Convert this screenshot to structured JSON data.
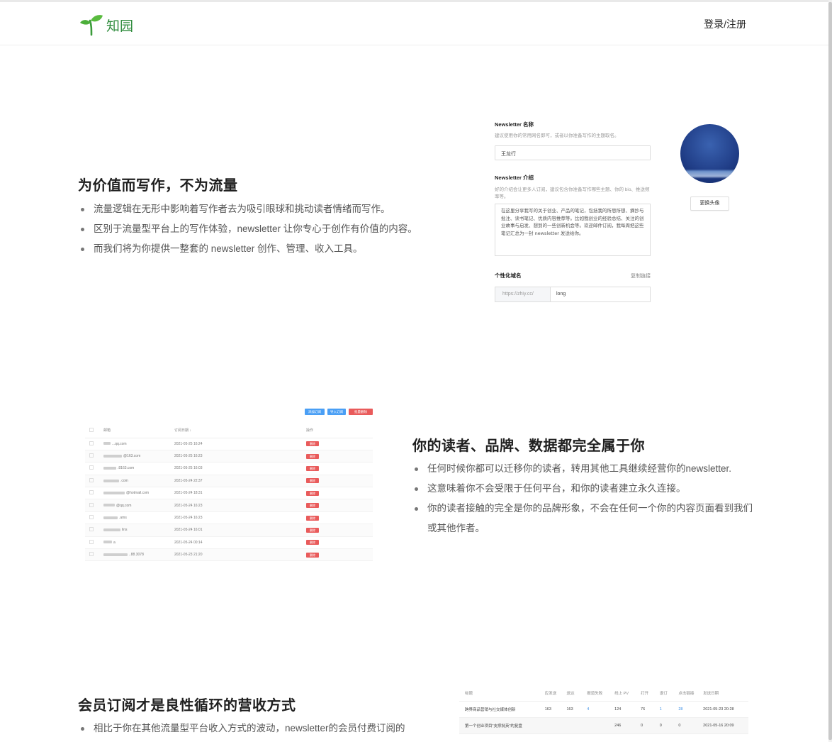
{
  "header": {
    "brand": "知园",
    "login_label": "登录/注册"
  },
  "section1": {
    "title": "为价值而写作，不为流量",
    "points": [
      "流量逻辑在无形中影响着写作者去为吸引眼球和挑动读者情绪而写作。",
      "区别于流量型平台上的写作体验，newsletter 让你专心于创作有价值的内容。",
      "而我们将为你提供一整套的 newsletter 创作、管理、收入工具。"
    ]
  },
  "form": {
    "name_label": "Newsletter 名称",
    "name_hint": "建议使用你的常用网名即可，或者以你准备写作的主题取名。",
    "name_value": "王龙行",
    "intro_label": "Newsletter 介绍",
    "intro_hint": "好的介绍会让更多人订阅，建议包含你准备写作哪些主题、你的 bio、推送频率等。",
    "intro_value": "在这里分享我写的关于创业、产品的笔记，包括我的所思所想、摘抄与批注、读书笔记、优质内容推荐等。比如我创业的经验总结、关注的创业故事与启发、想到的一些创新机会等。欢迎邮件订阅，我每周把这些笔记汇总为一封 newsletter 发送给你。",
    "domain_label": "个性化域名",
    "copy_link": "复制链接",
    "domain_prefix": "https://zhiy.cc/",
    "domain_value": "long",
    "change_avatar": "更换头像"
  },
  "section2": {
    "title": "你的读者、品牌、数据都完全属于你",
    "points": [
      "任何时候你都可以迁移你的读者，转用其他工具继续经营你的newsletter.",
      "这意味着你不会受限于任何平台，和你的读者建立永久连接。",
      "你的读者接触的完全是你的品牌形象，不会在任何一个你的内容页面看到我们或其他作者。"
    ]
  },
  "subs": {
    "buttons": [
      {
        "label": "添加订阅",
        "color": "#4a9ff5"
      },
      {
        "label": "导入订阅",
        "color": "#4a9ff5"
      },
      {
        "label": "批量删除",
        "color": "#e95b5b"
      }
    ],
    "columns": [
      "",
      "邮箱",
      "订阅日期 ↓",
      "操作"
    ],
    "delete_label": "删除",
    "rows": [
      {
        "email": "...qq.com",
        "date": "2021-05-25 16:24"
      },
      {
        "email": "@163.com",
        "date": "2021-05-25 16:23"
      },
      {
        "email": ".8163.com",
        "date": "2021-05-25 16:03"
      },
      {
        "email": ".com",
        "date": "2021-05-24 22:37"
      },
      {
        "email": "@hotmail.com",
        "date": "2021-05-24 18:31"
      },
      {
        "email": "@qq.com",
        "date": "2021-05-24 16:23"
      },
      {
        "email": ".ams",
        "date": "2021-05-24 16:23"
      },
      {
        "email": "lins",
        "date": "2021-05-24 16:01"
      },
      {
        "email": "a",
        "date": "2021-05-24 00:14"
      },
      {
        "email": "..88.3078",
        "date": "2021-05-23 21:20"
      }
    ]
  },
  "section3": {
    "title": "会员订阅才是良性循环的营收方式",
    "points": [
      "相比于你在其他流量型平台收入方式的波动，newsletter的会员付费订阅的"
    ]
  },
  "stats": {
    "columns": [
      "标题",
      "应发送",
      "送达",
      "报道失败",
      "线上 PV",
      "打开",
      "退订",
      "点击链接",
      "发送日期"
    ],
    "rows": [
      [
        "跨界商品营销与社交媒体创新",
        "163",
        "163",
        "4",
        "124",
        "76",
        "1",
        "28",
        "2021-05-23 20:28"
      ],
      [
        "第一个创业项目\"支撑批英\"的复盘",
        "",
        "",
        "",
        "246",
        "0",
        "0",
        "0",
        "2021-05-16 20:09"
      ]
    ]
  }
}
